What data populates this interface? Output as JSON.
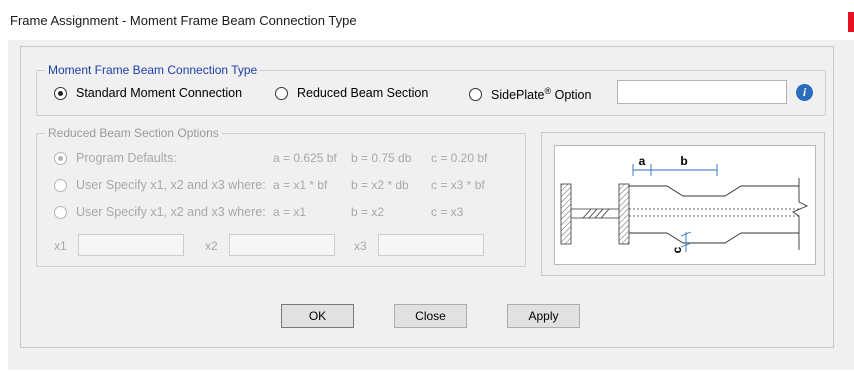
{
  "window": {
    "title": "Frame Assignment - Moment Frame Beam Connection Type"
  },
  "connection_group": {
    "legend": "Moment Frame Beam Connection Type",
    "options": [
      {
        "label": "Standard Moment Connection",
        "selected": true
      },
      {
        "label": "Reduced Beam Section",
        "selected": false
      },
      {
        "label": "SidePlate",
        "mark": "®",
        "label_suffix": " Option",
        "selected": false
      }
    ],
    "sideplate_field_value": "",
    "info_icon": "info-icon"
  },
  "rbs_group": {
    "legend": "Reduced Beam Section Options",
    "rows": [
      {
        "label": "Program Defaults:",
        "a": "a = 0.625 bf",
        "b": "b = 0.75 db",
        "c": "c = 0.20 bf",
        "selected": true
      },
      {
        "label": "User Specify x1,  x2 and x3 where:",
        "a": "a = x1 * bf",
        "b": "b = x2 * db",
        "c": "c = x3 * bf",
        "selected": false
      },
      {
        "label": "User Specify x1,  x2 and x3 where:",
        "a": "a = x1",
        "b": "b = x2",
        "c": "c = x3",
        "selected": false
      }
    ],
    "fields": [
      {
        "label": "x1",
        "value": ""
      },
      {
        "label": "x2",
        "value": ""
      },
      {
        "label": "x3",
        "value": ""
      }
    ]
  },
  "diagram": {
    "label_a": "a",
    "label_b": "b",
    "label_c": "c"
  },
  "buttons": {
    "ok": "OK",
    "close": "Close",
    "apply": "Apply"
  },
  "colors": {
    "legend_active": "#1c3faa",
    "disabled_text": "#a8a8a8",
    "info_icon": "#2a6ebb",
    "close_accent": "#e81123"
  }
}
